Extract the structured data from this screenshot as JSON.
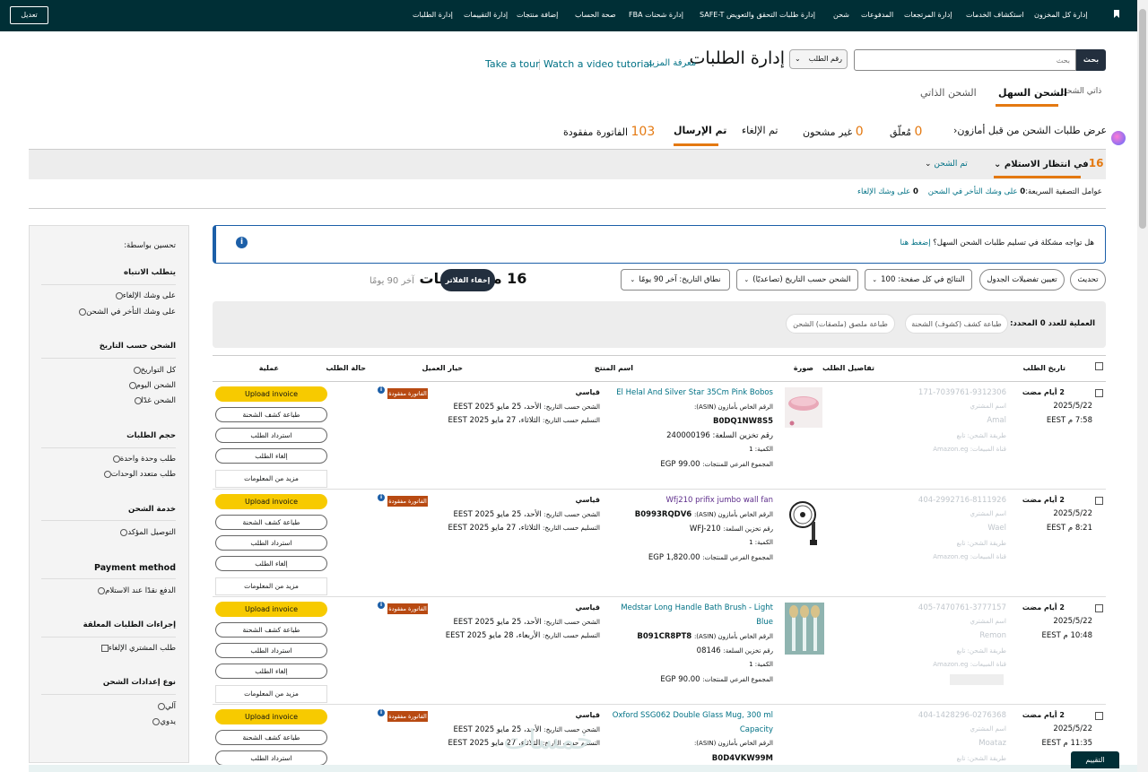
{
  "topnav": {
    "edit": "تعديل",
    "items": [
      "إدارة كل المخزون",
      "استكشاف الخدمات",
      "إدارة المرتجعات",
      "المدفوعات",
      "شحن",
      "إدارة طلبات التحقق والتعويض SAFE-T",
      "إدارة شحنات FBA",
      "صحة الحساب",
      "إضافة منتجات",
      "إدارة التقييمات",
      "إدارة الطلبات"
    ]
  },
  "search": {
    "button": "بحث",
    "placeholder": "بحث",
    "type": "رقم الطلب"
  },
  "header": {
    "title": "إدارة الطلبات",
    "learn_more": "معرفة المزيد",
    "video": "Watch a video tutorial",
    "tour": "Take a tour"
  },
  "fulfillment_tabs": {
    "self_ship": "ذاتي الشحن",
    "easy": "الشحن السهل",
    "self": "الشحن الذاتي"
  },
  "status_tabs": {
    "prefulfilled": "عرض طلبات الشحن من قبل أمازون",
    "pending_count": "0",
    "pending": "مُعلّق",
    "unshipped_count": "0",
    "unshipped": "غير مشحون",
    "cancelled": "تم الإلغاء",
    "sent": "تم الإرسال",
    "missing_count": "103",
    "missing": "الفاتورة مفقودة"
  },
  "subtabs": {
    "waiting_count": "16",
    "waiting": "في انتظار الاستلام",
    "shipped": "تم الشحن"
  },
  "quick_filters": {
    "label": "عوامل التصفية السريعة:",
    "late_count": "0",
    "late": "على وشك التأخر في الشحن",
    "cancel_count": "0",
    "cancel": "على وشك الإلغاء"
  },
  "filters": {
    "refine": "تحسين بواسطة:",
    "groups": [
      {
        "title": "يتطلب الانتباه",
        "options": [
          "على وشك الإلغاء",
          "على وشك التأخر في الشحن"
        ]
      },
      {
        "title": "الشحن حسب التاريخ",
        "options": [
          "كل التواريخ",
          "الشحن اليوم",
          "الشحن غدًا"
        ]
      },
      {
        "title": "حجم الطلبات",
        "options": [
          "طلب وحدة واحدة",
          "طلب متعدد الوحدات"
        ]
      },
      {
        "title": "خدمة الشحن",
        "options": [
          "التوصيل المؤكد"
        ]
      },
      {
        "title": "Payment method",
        "options": [
          "الدفع نقدًا عند الاستلام"
        ]
      },
      {
        "title": "إجراءات الطلبات المعلقة",
        "options": [
          "طلب المشتري الإلغاء"
        ]
      },
      {
        "title": "نوع إعدادات الشحن",
        "options": [
          "آلي",
          "يدوي"
        ]
      }
    ]
  },
  "banner": {
    "text": "هل تواجه مشكلة في تسليم طلبات الشحن السهل؟",
    "link": "إضغط هنا"
  },
  "toolbar": {
    "refresh": "تحديث",
    "prefs": "تعيين تفضيلات الجدول",
    "per_page": "النتائج في كل صفحة: 100",
    "sort": "الشحن حسب التاريخ (تصاعديًا)",
    "range": "نطاق التاريخ: آخر 90 يومًا",
    "count": "16 من الطلبات",
    "count_sub": "آخر 90 يومًا",
    "hide_filters": "إخفاء الفلاتر"
  },
  "bulk": {
    "label_prefix": "العملية للعدد",
    "label_count": "0",
    "label_suffix": "المحدد:",
    "packing": "طباعة كشف (كشوف) الشحنة",
    "labels": "طباعة ملصق (ملصقات) الشحن"
  },
  "table_headers": {
    "date": "تاريخ الطلب",
    "details": "تفاصيل الطلب",
    "image": "صورة",
    "product": "اسم المنتج",
    "customer_option": "خيار العميل",
    "status": "حالة الطلب",
    "action": "عملية"
  },
  "row_labels": {
    "buyer": "اسم المشتري",
    "channel": "طريقة الشحن: تابع",
    "sales_channel": "قناة المبيعات:",
    "asin": "الرقم الخاص بأمازون (ASIN):",
    "sku": "رقم تخزين السلعة:",
    "qty": "الكمية:",
    "subtotal": "المجموع الفرعي للمنتجات:",
    "ship_by": "الشحن حسب التاريخ:",
    "deliver_by": "التسليم حسب التاريخ:",
    "standard": "قياسي",
    "missing_badge": "الفاتورة مفقودة",
    "upload": "Upload invoice",
    "print_slip": "طباعة كشف الشحنة",
    "refund": "استرداد الطلب",
    "cancel": "إلغاء الطلب",
    "more": "مزيد من المعلومات"
  },
  "orders": [
    {
      "age": "2 أيام مضت",
      "date": "2025/5/22",
      "time": "7:58 م EEST",
      "order_id": "171-7039761-9312306",
      "buyer": "Amal",
      "channel": "Amazon.eg",
      "product": "El Helal And Silver Star 35Cm Pink Bobos",
      "product_line2": "",
      "asin": "B0DQ1NW8S5",
      "sku": "240000196",
      "qty": "1",
      "subtotal": "EGP 99.00",
      "ship_date": "الأحد، 25 مايو EEST 2025",
      "deliver_date": "الثلاثاء، 27 مايو EEST 2025"
    },
    {
      "age": "2 أيام مضت",
      "date": "2025/5/22",
      "time": "8:21 م EEST",
      "order_id": "404-2992716-8111926",
      "buyer": "Wael",
      "channel": "Amazon.eg",
      "product": "Wfj210 prifix jumbo wall fan",
      "product_line2": "",
      "asin": "B0993RQDV6",
      "sku": "WFJ-210",
      "qty": "1",
      "subtotal": "EGP 1,820.00",
      "ship_date": "الأحد، 25 مايو EEST 2025",
      "deliver_date": "الثلاثاء، 27 مايو EEST 2025"
    },
    {
      "age": "2 أيام مضت",
      "date": "2025/5/22",
      "time": "10:48 م EEST",
      "order_id": "405-7470761-3777157",
      "buyer": "Remon",
      "channel": "Amazon.eg",
      "product": "Medstar Long Handle Bath Brush - Light",
      "product_line2": "Blue",
      "asin": "B091CR8PT8",
      "sku": "08146",
      "qty": "1",
      "subtotal": "EGP 90.00",
      "ship_date": "الأحد، 25 مايو EEST 2025",
      "deliver_date": "الأربعاء، 28 مايو EEST 2025"
    },
    {
      "age": "2 أيام مضت",
      "date": "2025/5/22",
      "time": "11:35 م EEST",
      "order_id": "404-1428296-0276368",
      "buyer": "Moataz",
      "channel": "Amazon.eg",
      "product": "Oxford SSG062 Double Glass Mug, 300 ml",
      "product_line2": "Capacity",
      "asin": "B0D4VKW99M",
      "sku": "",
      "qty": "",
      "subtotal": "",
      "ship_date": "الأحد، 25 مايو EEST 2025",
      "deliver_date": "الثلاثاء، 27 مايو EEST 2025"
    }
  ],
  "feedback": "التقييم"
}
